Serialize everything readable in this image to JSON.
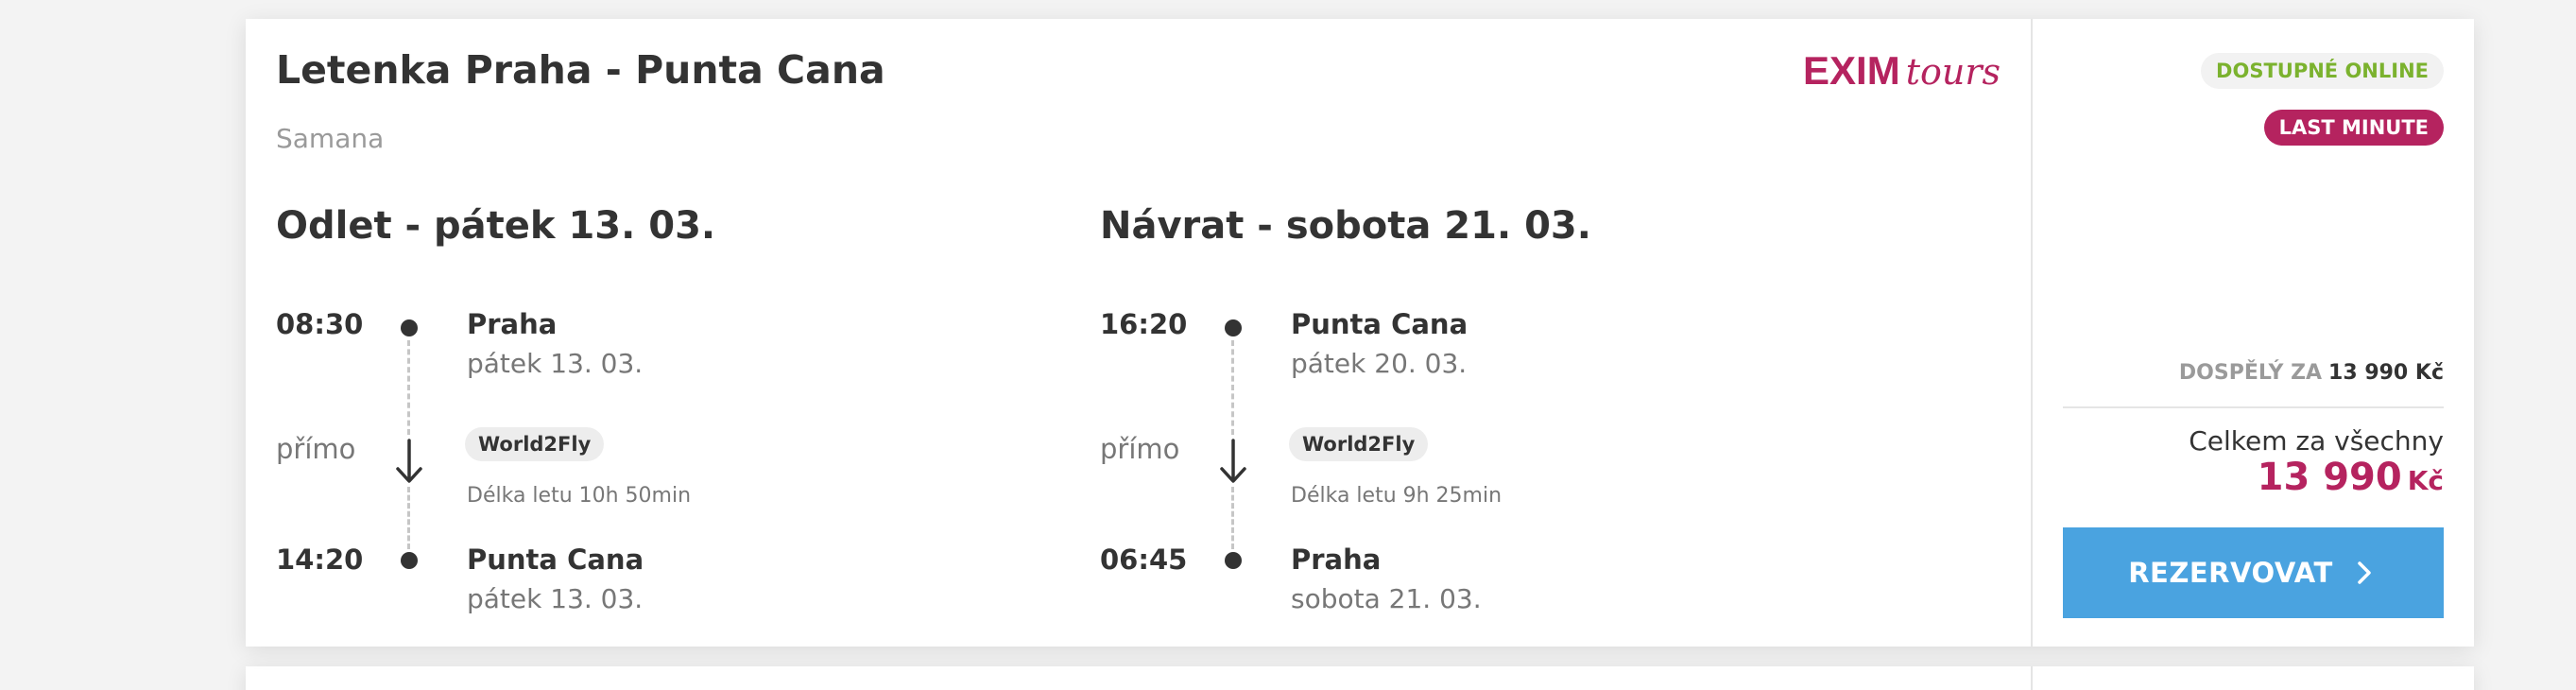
{
  "card": {
    "title": "Letenka Praha - Punta Cana",
    "subtitle": "Samana",
    "logo": {
      "brand": "EXIM",
      "suffix": "tours",
      "color": "#b5235f"
    }
  },
  "outbound": {
    "heading": "Odlet - pátek 13. 03.",
    "departure": {
      "time": "08:30",
      "place": "Praha",
      "date": "pátek 13. 03."
    },
    "stops_label": "přímo",
    "airline": "World2Fly",
    "duration": "Délka letu 10h 50min",
    "arrival": {
      "time": "14:20",
      "place": "Punta Cana",
      "date": "pátek 13. 03."
    }
  },
  "return": {
    "heading": "Návrat - sobota 21. 03.",
    "departure": {
      "time": "16:20",
      "place": "Punta Cana",
      "date": "pátek 20. 03."
    },
    "stops_label": "přímo",
    "airline": "World2Fly",
    "duration": "Délka letu 9h 25min",
    "arrival": {
      "time": "06:45",
      "place": "Praha",
      "date": "sobota 21. 03."
    }
  },
  "sidebar": {
    "badge_online": "DOSTUPNÉ ONLINE",
    "badge_last_minute": "LAST MINUTE",
    "adult_label": "DOSPĚLÝ ZA",
    "adult_price": "13 990 Kč",
    "total_label": "Celkem za všechny",
    "total_amount": "13 990",
    "total_currency": "Kč",
    "book_button": "REZERVOVAT"
  },
  "colors": {
    "accent": "#b5235f",
    "online_green": "#7bb22e",
    "button_blue": "#4aa3e0"
  },
  "icons": {
    "direction": "arrow-down-icon",
    "button": "chevron-right-icon"
  }
}
